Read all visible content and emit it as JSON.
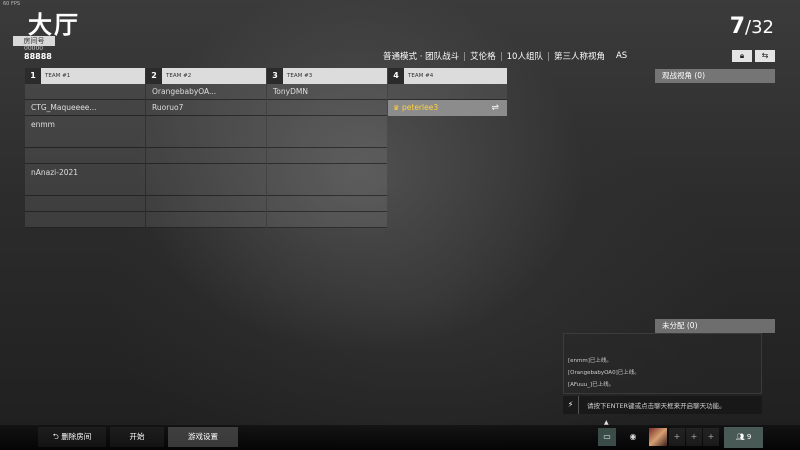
{
  "fps": "60 FPS",
  "header": {
    "title": "大厅",
    "room_label": "房间号",
    "room_number_small": "00000",
    "room_number": "88888",
    "player_count": "7",
    "player_max": "/32"
  },
  "modes": [
    "普通模式 · 团队战斗",
    "艾伦格",
    "10人组队",
    "第三人称视角",
    "AS"
  ],
  "icons": {
    "lock": "lock-icon",
    "swap": "swap-icon"
  },
  "teams": [
    {
      "num": "1",
      "label": "TEAM #1",
      "slots": [
        "",
        "CTG_Maqueeee...",
        "enmm",
        "",
        "nAnazi-2021",
        "",
        ""
      ]
    },
    {
      "num": "2",
      "label": "TEAM #2",
      "slots": [
        "OrangebabyOA...",
        "Ruoruo7",
        "",
        "",
        "",
        "",
        ""
      ]
    },
    {
      "num": "3",
      "label": "TEAM #3",
      "slots": [
        "TonyDMN",
        "",
        "",
        "",
        "",
        "",
        ""
      ]
    },
    {
      "num": "4",
      "label": "TEAM #4",
      "slots": [
        "",
        "peterlee3"
      ]
    }
  ],
  "spectator": {
    "label": "观战视角 (0)"
  },
  "unassigned": {
    "label": "未分配 (0)"
  },
  "chat": {
    "messages": [
      "[enmm]已上线。",
      "[OrangebabyOA0]已上线。",
      "[AFuuu_]已上线。"
    ],
    "hint": "请按下ENTER键或点击聊天框来开启聊天功能。"
  },
  "bottom": {
    "leave": "⮌ 删除房间",
    "start": "开始",
    "settings": "游戏设置",
    "invite_count": "9"
  },
  "colors": {
    "highlight_name": "#ffd23a",
    "team_header": "#dcdcdc"
  }
}
